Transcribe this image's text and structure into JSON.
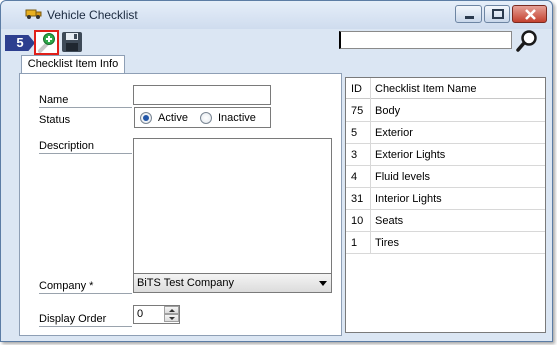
{
  "window": {
    "title": "Vehicle Checklist"
  },
  "toolbar": {
    "step_number": "5",
    "search_value": ""
  },
  "tabs": [
    {
      "label": "Checklist Item Info"
    }
  ],
  "form": {
    "name_label": "Name",
    "name_value": "",
    "status_label": "Status",
    "status_options": [
      {
        "label": "Active",
        "checked": true
      },
      {
        "label": "Inactive",
        "checked": false
      }
    ],
    "description_label": "Description",
    "description_value": "",
    "company_label": "Company *",
    "company_value": "BiTS Test Company",
    "display_order_label": "Display Order",
    "display_order_value": "0"
  },
  "grid": {
    "headers": [
      "ID",
      "Checklist Item Name"
    ],
    "rows": [
      {
        "id": "75",
        "name": "Body"
      },
      {
        "id": "5",
        "name": "Exterior"
      },
      {
        "id": "3",
        "name": "Exterior Lights"
      },
      {
        "id": "4",
        "name": "Fluid levels"
      },
      {
        "id": "31",
        "name": "Interior Lights"
      },
      {
        "id": "10",
        "name": "Seats"
      },
      {
        "id": "1",
        "name": "Tires"
      }
    ]
  },
  "colors": {
    "accent_red": "#e0201a",
    "badge_blue": "#2d3f8f",
    "window_bg": "#dbe6f3"
  },
  "icons": {
    "title": "truck-icon",
    "new": "add-new-icon",
    "save": "save-disk-icon",
    "search": "magnifier-icon"
  }
}
